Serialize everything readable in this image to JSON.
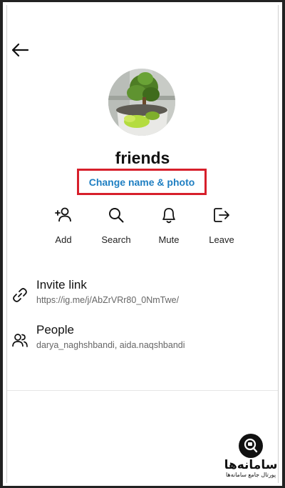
{
  "header": {
    "back_icon": "arrow-left-icon"
  },
  "group": {
    "name": "friends",
    "change_label": "Change name & photo",
    "highlight_color": "#d71f2b",
    "link_color": "#1f7fc2"
  },
  "actions": [
    {
      "label": "Add",
      "icon": "add-person-icon"
    },
    {
      "label": "Search",
      "icon": "search-icon"
    },
    {
      "label": "Mute",
      "icon": "bell-icon"
    },
    {
      "label": "Leave",
      "icon": "leave-icon"
    }
  ],
  "invite": {
    "title": "Invite link",
    "url": "https://ig.me/j/AbZrVRr80_0NmTwe/"
  },
  "people": {
    "title": "People",
    "members": "darya_naghshbandi, aida.naqshbandi"
  },
  "watermark": {
    "name": "سامانه‌ها",
    "subtitle": "پورتال جامع سامانه‌ها"
  }
}
